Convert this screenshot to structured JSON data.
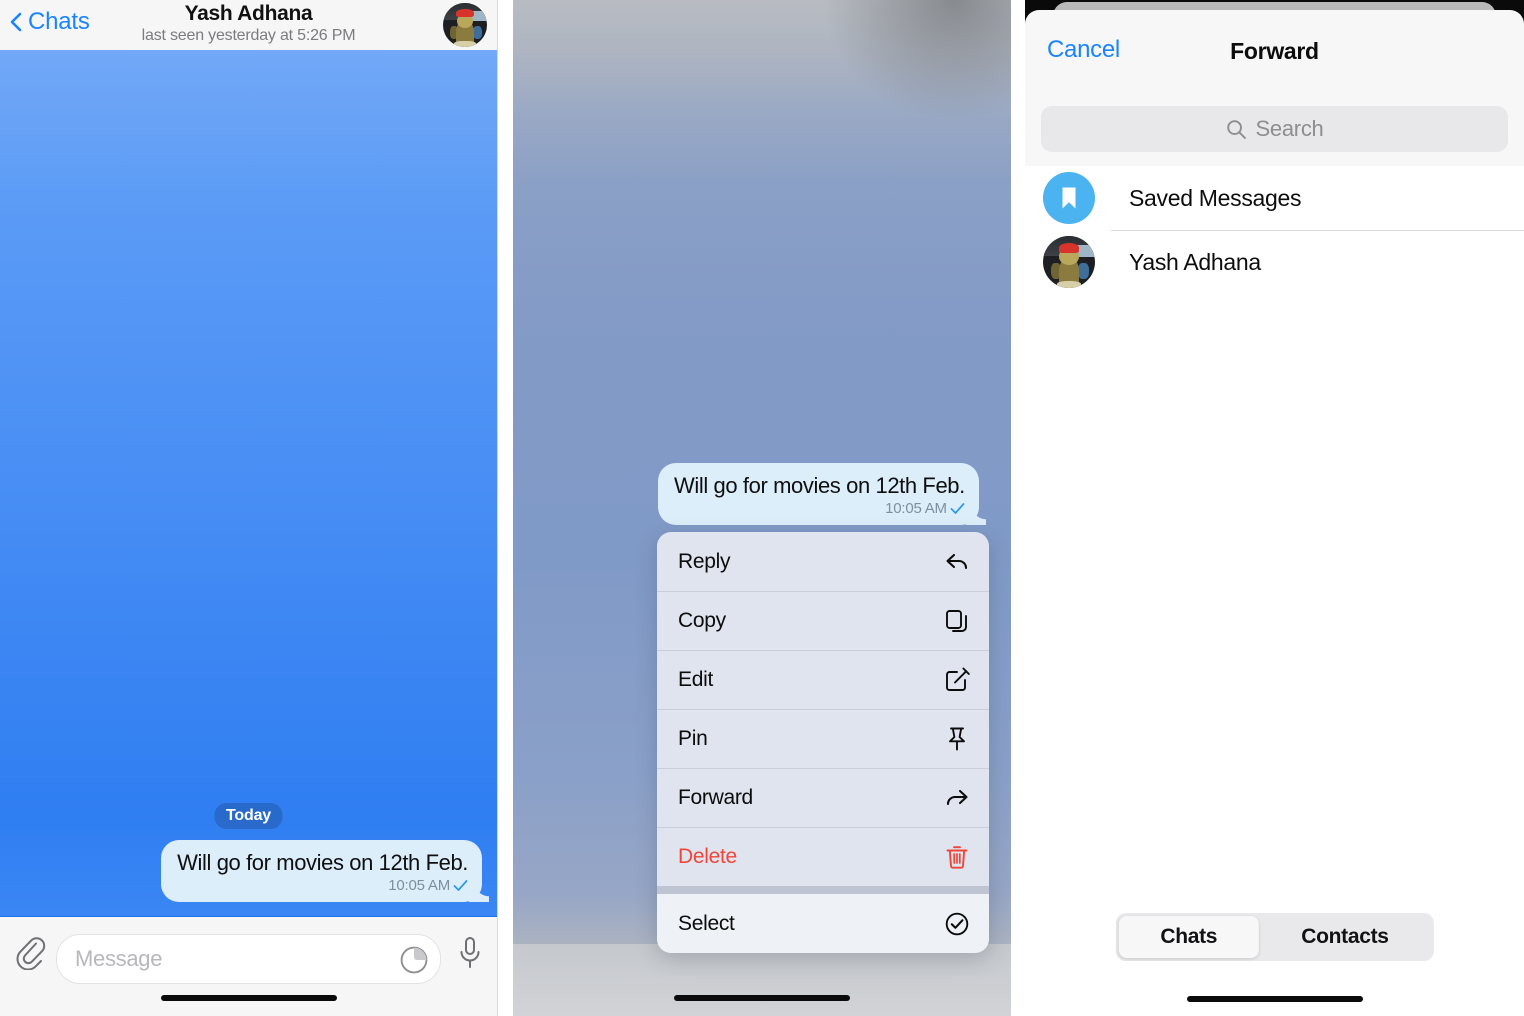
{
  "panel1": {
    "header": {
      "back_label": "Chats",
      "back_icon": "chevron-left-icon",
      "title": "Yash Adhana",
      "subtitle": "last seen yesterday at 5:26 PM",
      "avatar_icon": "contact-avatar"
    },
    "date_separator": "Today",
    "message": {
      "text": "Will go for movies on 12th Feb.",
      "time": "10:05 AM",
      "status_icon": "single-check-icon"
    },
    "input_bar": {
      "attach_icon": "paperclip-icon",
      "placeholder": "Message",
      "sticker_icon": "sticker-icon",
      "mic_icon": "microphone-icon"
    }
  },
  "panel2": {
    "message": {
      "text": "Will go for movies on 12th Feb.",
      "time": "10:05 AM",
      "status_icon": "single-check-icon"
    },
    "context_menu": [
      {
        "label": "Reply",
        "icon": "reply-arrow-icon",
        "destructive": false
      },
      {
        "label": "Copy",
        "icon": "copy-pages-icon",
        "destructive": false
      },
      {
        "label": "Edit",
        "icon": "edit-pencil-icon",
        "destructive": false
      },
      {
        "label": "Pin",
        "icon": "pushpin-icon",
        "destructive": false
      },
      {
        "label": "Forward",
        "icon": "forward-arrow-icon",
        "destructive": false
      },
      {
        "label": "Delete",
        "icon": "trash-can-icon",
        "destructive": true
      },
      {
        "label": "Select",
        "icon": "check-circle-icon",
        "destructive": false
      }
    ]
  },
  "panel3": {
    "sheet": {
      "cancel_label": "Cancel",
      "title": "Forward",
      "search_placeholder": "Search",
      "search_icon": "search-icon"
    },
    "rows": [
      {
        "label": "Saved Messages",
        "avatar": "bookmark-icon"
      },
      {
        "label": "Yash Adhana",
        "avatar": "contact-avatar"
      }
    ],
    "segments": [
      {
        "label": "Chats",
        "selected": true
      },
      {
        "label": "Contacts",
        "selected": false
      }
    ]
  },
  "colors": {
    "accent_blue": "#1a84ff",
    "chat_gradient_top": "#72a8f7",
    "chat_gradient_bottom": "#2f7ef2",
    "bubble_blue": "#ddeefb",
    "destructive_red": "#f0463a",
    "saved_badge_blue": "#4bb3ef"
  }
}
